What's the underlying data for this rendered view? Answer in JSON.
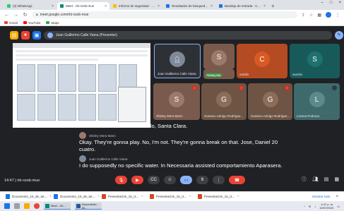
{
  "browser": {
    "tabs": [
      {
        "title": "(3) WhatsApp",
        "color": "#25d366",
        "active": false
      },
      {
        "title": "Meet - rbi-nzsb-mue",
        "color": "#00897b",
        "active": true
      },
      {
        "title": "Informe de seguridad - contratación",
        "color": "#fbbc04",
        "active": false
      },
      {
        "title": "Resultados de búsqueda - Docu",
        "color": "#1a73e8",
        "active": false
      },
      {
        "title": "Bandeja de entrada - Correo",
        "color": "#1a73e8",
        "active": false
      }
    ],
    "url": "meet.google.com/rbi-nzsb-mue",
    "bookmarks": [
      {
        "label": "Gmail",
        "color": "#ea4335"
      },
      {
        "label": "YouTube",
        "color": "#ff0000"
      },
      {
        "label": "Maps",
        "color": "#34a853"
      }
    ]
  },
  "meet": {
    "presenter_label": "Juan Guillermo Calle Viana (Presenter)",
    "tiles": [
      {
        "name": "Juan Guillermo Calle Viana",
        "initial": "",
        "bg": "#2d3136",
        "avatar": "#7f8a99"
      },
      {
        "name": "Shirley Ma",
        "initial": "S",
        "bg": "#7a5a4c",
        "avatar": "#9b7a6a"
      },
      {
        "name": "camilo",
        "initial": "C",
        "bg": "#b44b22",
        "avatar": "#d85a22"
      },
      {
        "name": "sandra",
        "initial": "S",
        "bg": "#185a5a",
        "avatar": "#1f7070"
      },
      {
        "name": "Shirley Mera Marin",
        "initial": "S",
        "bg": "#7a5a4c",
        "avatar": "#9b7a6a"
      },
      {
        "name": "Gustavo Adolgo Rodrígue...",
        "initial": "G",
        "bg": "#6e5444",
        "avatar": "#8c6d5a"
      },
      {
        "name": "Gustavo Adolgo Rodrígue...",
        "initial": "G",
        "bg": "#6e5444",
        "avatar": "#8c6d5a"
      },
      {
        "name": "Lorena Pedraza",
        "initial": "L",
        "bg": "#3f6a6c",
        "avatar": "#5b8a8c"
      }
    ],
    "captions": {
      "line0": "secure recommend ideas. Hello, Santa Clara.",
      "speaker1": "Shirley Mera Marin",
      "line1": "Okay. They're gonna play. No, I'm not. They're gonna break on that. Jose, Daniel 20 cuatro.",
      "speaker2": "Juan Guillermo Calle Viana",
      "line2": "I do supposedly no specific water. In Necessaria assisted comportamiento Aparasera."
    },
    "meeting_info": "14:47 | rbi-nzsb-mue"
  },
  "downloads": {
    "items": [
      "Documento_16_de_tut....",
      "Documento_15_de_tut....",
      "Presentación_15_d....",
      "Presentación_15_d....",
      "Presentación_15_d...."
    ],
    "show_all": "Mostrar todo"
  },
  "taskbar": {
    "apps": [
      {
        "label": "Meet - rbi-...",
        "color": "#00897b"
      },
      {
        "label": "Documento - W...",
        "color": "#2b579a"
      }
    ],
    "time": "4:47 p. m.",
    "date": "19/07/2023"
  }
}
